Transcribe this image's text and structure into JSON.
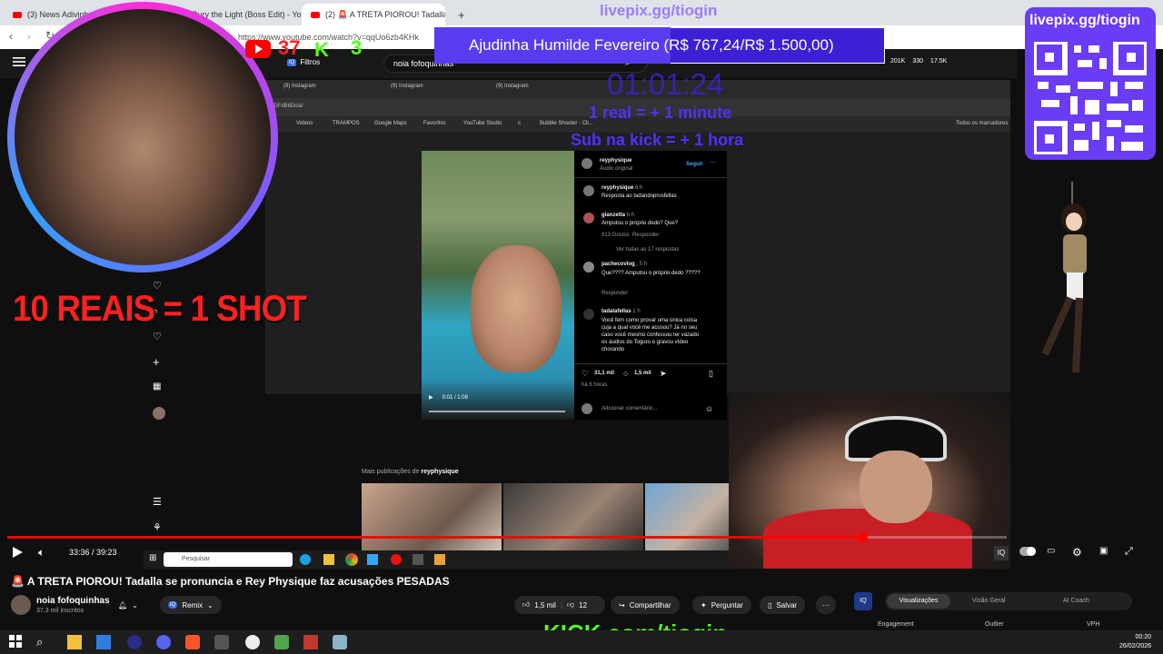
{
  "browser": {
    "tabs": [
      {
        "label": "(3) News Adivinho - YouTube"
      },
      {
        "label": "(3) Bury the Light (Boss Edit) - YouTu"
      },
      {
        "label": "(2) 🚨 A TRETA PIOROU! Tadalla"
      }
    ],
    "url": "https://www.youtube.com/watch?v=qqUo6zb4KHk"
  },
  "overlay": {
    "livepix_top": "livepix.gg/tiogin",
    "goal_text": "Ajudinha Humilde Fevereiro (R$ 767,24/R$ 1.500,00)",
    "timer": "01:01:24",
    "rule_1": "1 real = + 1 minute",
    "rule_2": "Sub na kick = + 1 hora",
    "youtube_viewers": "37",
    "kick_viewers": "3",
    "shot_text": "10 REAIS = 1 SHOT",
    "qr_label": "livepix.gg/tiogin",
    "kick_url": "KICK.com/tiogin"
  },
  "studio": {
    "search_value": "noia fofoquinhas",
    "filters_label": "Filtros",
    "stats": [
      "201K",
      "330",
      "17.5K"
    ]
  },
  "inner_browser": {
    "tabs": [
      "(9) Instagram",
      "(9) Instagram",
      "(9) Instagram"
    ],
    "address": "3DFdB8Dcia/",
    "bookmarks": [
      "Videos",
      "TRAMPOS",
      "Google Maps",
      "Favoritos",
      "YouTube Studio",
      "c",
      "Bubble Shooter - Cli..."
    ],
    "all_bookmarks": "Todos os marcadores"
  },
  "instagram": {
    "user": "reyphysique",
    "audio": "Áudio original",
    "follow": "Seguir",
    "comments": [
      {
        "user": "reyphysique",
        "time": "6 h",
        "text": "Resposta ao tadandoprosfellas"
      },
      {
        "user": "gianzetta",
        "time": "6 h",
        "text": "Amputou o próprio dedo? Que?",
        "likes": "913 Gostos",
        "reply": "Responder",
        "more": "Ver todas as 17 respostas"
      },
      {
        "user": "pachecovlog_",
        "time": "5 h",
        "text": "Que???? Amputou o próprio dedo ?????",
        "reply": "Responder"
      },
      {
        "user": "tadalafellas",
        "time": "1 h",
        "text": "Você fem como provar uma única coisa cuja a qual você me acusou? Já no seu caso você mesmo confessou ter vazado os áudios do Toguro e gravou vídeo chorando"
      }
    ],
    "likes": "31,1 mil",
    "comment_count": "1,5 mil",
    "posted": "há 6 horas",
    "add_comment": "Adicionar comentário...",
    "video_time": "0:01 / 1:08",
    "more_posts": "Mais publicações de",
    "more_posts_user": "reyphysique"
  },
  "player": {
    "time": "33:36 / 39:23",
    "progress": 0.855
  },
  "inner_taskbar": {
    "search_placeholder": "Pesquisar"
  },
  "video": {
    "title": "🚨 A TRETA PIOROU! Tadalla se pronuncia e Rey Physique faz acusações PESADAS",
    "channel": "noia fofoquinhas",
    "subscribers": "37,3 mil inscritos",
    "remix": "Remix",
    "likes": "1,5 mil",
    "dislikes": "12",
    "share": "Compartilhar",
    "ask": "Perguntar",
    "save": "Salvar"
  },
  "side_panel": {
    "tabs": [
      "Visualizações",
      "Visão Geral",
      "AI Coach"
    ],
    "cols": [
      "Engagement",
      "Outlier",
      "VPH"
    ]
  },
  "clock": {
    "time": "00:20",
    "date": "26/02/2026"
  },
  "colors": {
    "accent_red": "#ff0000",
    "kick_green": "#53fc18",
    "livepix_purple": "#6a3cf5"
  }
}
